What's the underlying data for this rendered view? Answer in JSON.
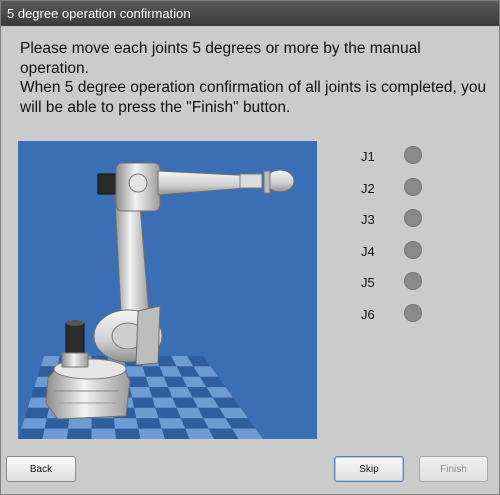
{
  "window": {
    "title": "5 degree operation confirmation"
  },
  "message": {
    "line1": "Please move each joints 5 degrees or more by the manual operation.",
    "line2": "When 5 degree operation confirmation of all joints is completed, you will be able to press the \"Finish\" button."
  },
  "joints": [
    {
      "label": "J1",
      "confirmed": false,
      "color": "#8a8a8a"
    },
    {
      "label": "J2",
      "confirmed": false,
      "color": "#8a8a8a"
    },
    {
      "label": "J3",
      "confirmed": false,
      "color": "#8a8a8a"
    },
    {
      "label": "J4",
      "confirmed": false,
      "color": "#8a8a8a"
    },
    {
      "label": "J5",
      "confirmed": false,
      "color": "#8a8a8a"
    },
    {
      "label": "J6",
      "confirmed": false,
      "color": "#8a8a8a"
    }
  ],
  "buttons": {
    "back": "Back",
    "skip": "Skip",
    "finish": "Finish",
    "finish_enabled": false
  },
  "colors": {
    "scene_background": "#3a6fb5",
    "grid_dark": "#2f5e9e",
    "grid_light": "#6f9bd3"
  }
}
